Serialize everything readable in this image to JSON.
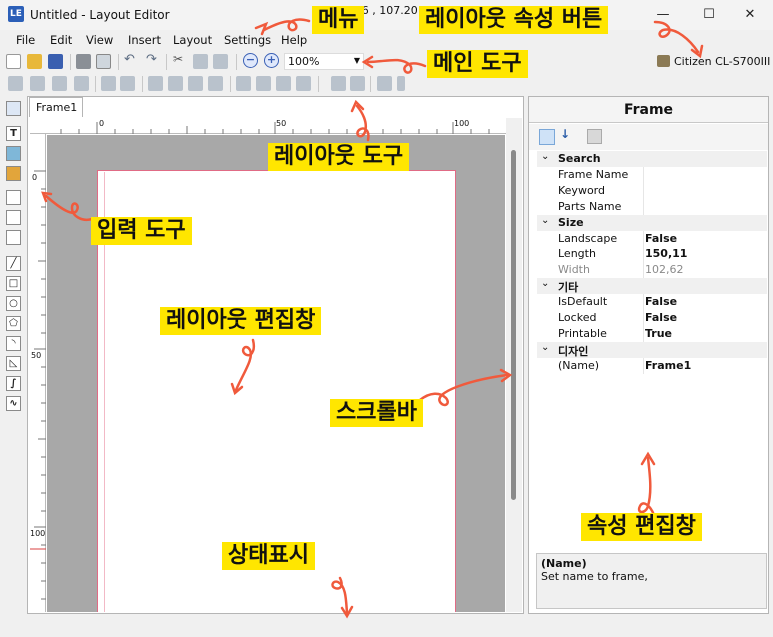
{
  "window": {
    "title": "Untitled - Layout Editor",
    "icon_label": "LE",
    "minimize": "—",
    "maximize": "☐",
    "close": "✕"
  },
  "menu": [
    "File",
    "Edit",
    "View",
    "Insert",
    "Layout",
    "Settings",
    "Help"
  ],
  "toolbar": {
    "zoom": "100%",
    "printer": "Citizen CL-S700III"
  },
  "editor": {
    "tab": "Frame1",
    "ruler_h": [
      "0",
      "50",
      "100"
    ],
    "ruler_v": [
      "0",
      "50",
      "100"
    ]
  },
  "properties": {
    "title": "Frame",
    "rows": [
      {
        "type": "category",
        "label": "Search"
      },
      {
        "type": "item",
        "label": "Frame Name",
        "value": ""
      },
      {
        "type": "item",
        "label": "Keyword",
        "value": ""
      },
      {
        "type": "item",
        "label": "Parts Name",
        "value": ""
      },
      {
        "type": "category",
        "label": "Size"
      },
      {
        "type": "item",
        "label": "Landscape",
        "value": "False"
      },
      {
        "type": "item",
        "label": "Length",
        "value": "150,11"
      },
      {
        "type": "item",
        "label": "Width",
        "value": "102,62",
        "disabled": true
      },
      {
        "type": "category",
        "label": "기타"
      },
      {
        "type": "item",
        "label": "IsDefault",
        "value": "False"
      },
      {
        "type": "item",
        "label": "Locked",
        "value": "False"
      },
      {
        "type": "item",
        "label": "Printable",
        "value": "True"
      },
      {
        "type": "category",
        "label": "디자인"
      },
      {
        "type": "item",
        "label": "(Name)",
        "value": "Frame1"
      }
    ],
    "description_title": "(Name)",
    "description_text": "Set name to frame,"
  },
  "status": {
    "text": "145.76 , 107.20 mm"
  },
  "annotations": {
    "menu": "메뉴",
    "layout_prop_button": "레이아웃 속성 버튼",
    "main_tools": "메인 도구",
    "layout_tools": "레이아웃 도구",
    "input_tools": "입력 도구",
    "layout_editor": "레이아웃 편집창",
    "scrollbar": "스크롤바",
    "property_editor": "속성 편집창",
    "status_display": "상태표시"
  },
  "colors": {
    "annotation_bg": "#ffe600",
    "arrow": "#f05a3c",
    "page_margin": "#e06b85",
    "canvas_grey": "#a8a8a8"
  }
}
